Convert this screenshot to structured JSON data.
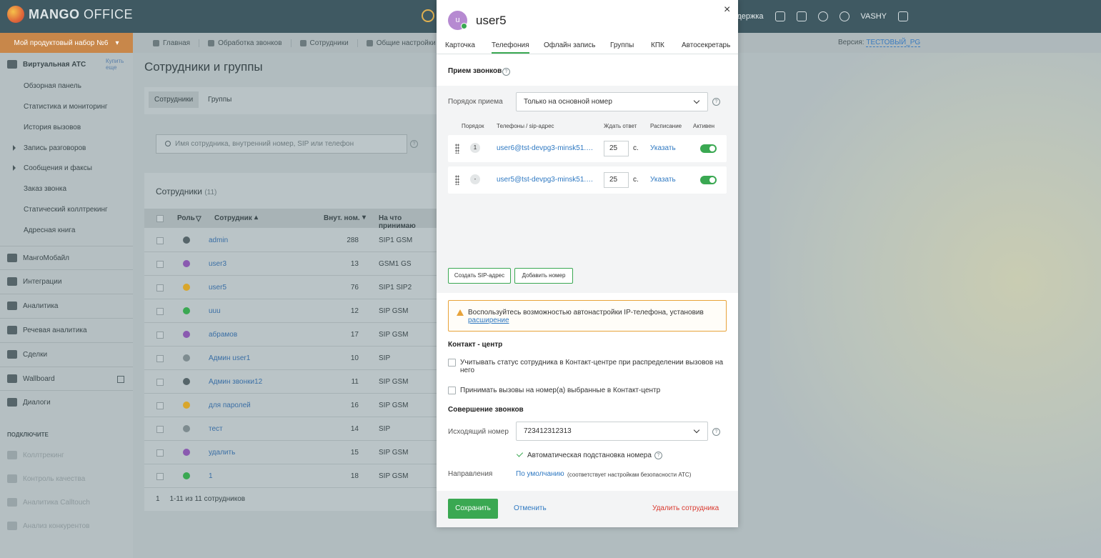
{
  "logo": {
    "text_bold": "MANGO",
    "text_rest": " OFFICE"
  },
  "topbar": {
    "support": "Поддержка",
    "user": "VASHY"
  },
  "product": {
    "label": "Мой продуктовый набор №6"
  },
  "nav": {
    "items": [
      "Главная",
      "Обработка звонков",
      "Сотрудники",
      "Общие настройки"
    ],
    "version_label": "Версия:",
    "version_value": "ТЕСТОВЫЙ_PG"
  },
  "sidebar": {
    "head": "Виртуальная АТС",
    "buy_line1": "Купить",
    "buy_line2": "еще",
    "sub_items": [
      "Обзорная панель",
      "Статистика и мониторинг",
      "История вызовов",
      "Запись разговоров",
      "Сообщения и факсы",
      "Заказ звонка",
      "Статический коллтрекинг",
      "Адресная книга"
    ],
    "main_items": [
      "МангоМобайл",
      "Интеграции",
      "Аналитика",
      "Речевая аналитика",
      "Сделки",
      "Wallboard",
      "Диалоги"
    ],
    "section_title": "ПОДКЛЮЧИТЕ",
    "dim_items": [
      "Коллтрекинг",
      "Контроль качества",
      "Аналитика Calltouch",
      "Анализ конкурентов"
    ]
  },
  "page": {
    "title": "Сотрудники и группы",
    "tab_employees": "Сотрудники",
    "tab_groups": "Группы",
    "search_placeholder": "Имя сотрудника, внутренний номер, SIP или телефон",
    "list_title": "Сотрудники",
    "list_count": "(11)",
    "columns": {
      "role": "Роль",
      "employee": "Сотрудник",
      "ext": "Внут. ном.",
      "devices": "На что принимаю"
    },
    "rows": [
      {
        "name": "admin",
        "ext": "288",
        "dev": "SIP1 GSM",
        "color": "#56656a"
      },
      {
        "name": "user3",
        "ext": "13",
        "dev": "GSM1 GS",
        "color": "#8a5ab0"
      },
      {
        "name": "user5",
        "ext": "76",
        "dev": "SIP1 SIP2",
        "color": "#d9a62c"
      },
      {
        "name": "uuu",
        "ext": "12",
        "dev": "SIP GSM",
        "color": "#3aa852"
      },
      {
        "name": "абрамов",
        "ext": "17",
        "dev": "SIP GSM",
        "color": "#8a5ab0"
      },
      {
        "name": "Админ user1",
        "ext": "10",
        "dev": "SIP",
        "color": "#7e8c90"
      },
      {
        "name": "Админ звонки12",
        "ext": "11",
        "dev": "SIP GSM",
        "color": "#56656a"
      },
      {
        "name": "для паролей",
        "ext": "16",
        "dev": "SIP GSM",
        "color": "#d9a62c"
      },
      {
        "name": "тест",
        "ext": "14",
        "dev": "SIP",
        "color": "#7e8c90"
      },
      {
        "name": "удалить",
        "ext": "15",
        "dev": "SIP GSM",
        "color": "#8a5ab0"
      },
      {
        "name": "1",
        "ext": "18",
        "dev": "SIP GSM",
        "color": "#3aa852"
      }
    ],
    "pager_page": "1",
    "pager_text": "1-11 из 11 сотрудников"
  },
  "modal": {
    "avatar_letter": "u",
    "title": "user5",
    "close": "×",
    "tabs": [
      "Карточка",
      "Телефония",
      "Офлайн запись",
      "Группы",
      "КПК",
      "Автосекретарь"
    ],
    "active_tab": "Телефония",
    "receive_title": "Прием звонков",
    "order_label": "Порядок приема",
    "order_value": "Только на основной номер",
    "col_order": "Порядок",
    "col_phones": "Телефоны / sip-адрес",
    "col_wait": "Ждать ответ",
    "col_schedule": "Расписание",
    "col_active": "Активен",
    "phones": [
      {
        "order": "1",
        "sip": "user6@tst-devpg3-minsk51.ma...",
        "wait": "25",
        "unit": "с.",
        "schedule": "Указать",
        "active": true
      },
      {
        "order": "-",
        "sip": "user5@tst-devpg3-minsk51.ma...",
        "wait": "25",
        "unit": "с.",
        "schedule": "Указать",
        "active": true
      }
    ],
    "btn_create_sip": "Создать SIP-адрес",
    "btn_add_number": "Добавить номер",
    "warning_text": "Воспользуйтесь возможностью автонастройки IP-телефона, установив",
    "warning_link": "расширение",
    "contact_center_title": "Контакт - центр",
    "cc_option1": "Учитывать статус сотрудника в Контакт-центре при распределении вызовов на него",
    "cc_option2": "Принимать вызовы на номер(а) выбранные в Контакт-центр",
    "calls_title": "Совершение звонков",
    "outgoing_label": "Исходящий номер",
    "outgoing_value": "723412312313",
    "auto_sub": "Автоматическая подстановка номера",
    "directions_label": "Направления",
    "directions_link": "По умолчанию",
    "directions_note": "(соответствует настройкам безопасности АТС)",
    "save": "Сохранить",
    "cancel": "Отменить",
    "delete": "Удалить сотрудника"
  }
}
